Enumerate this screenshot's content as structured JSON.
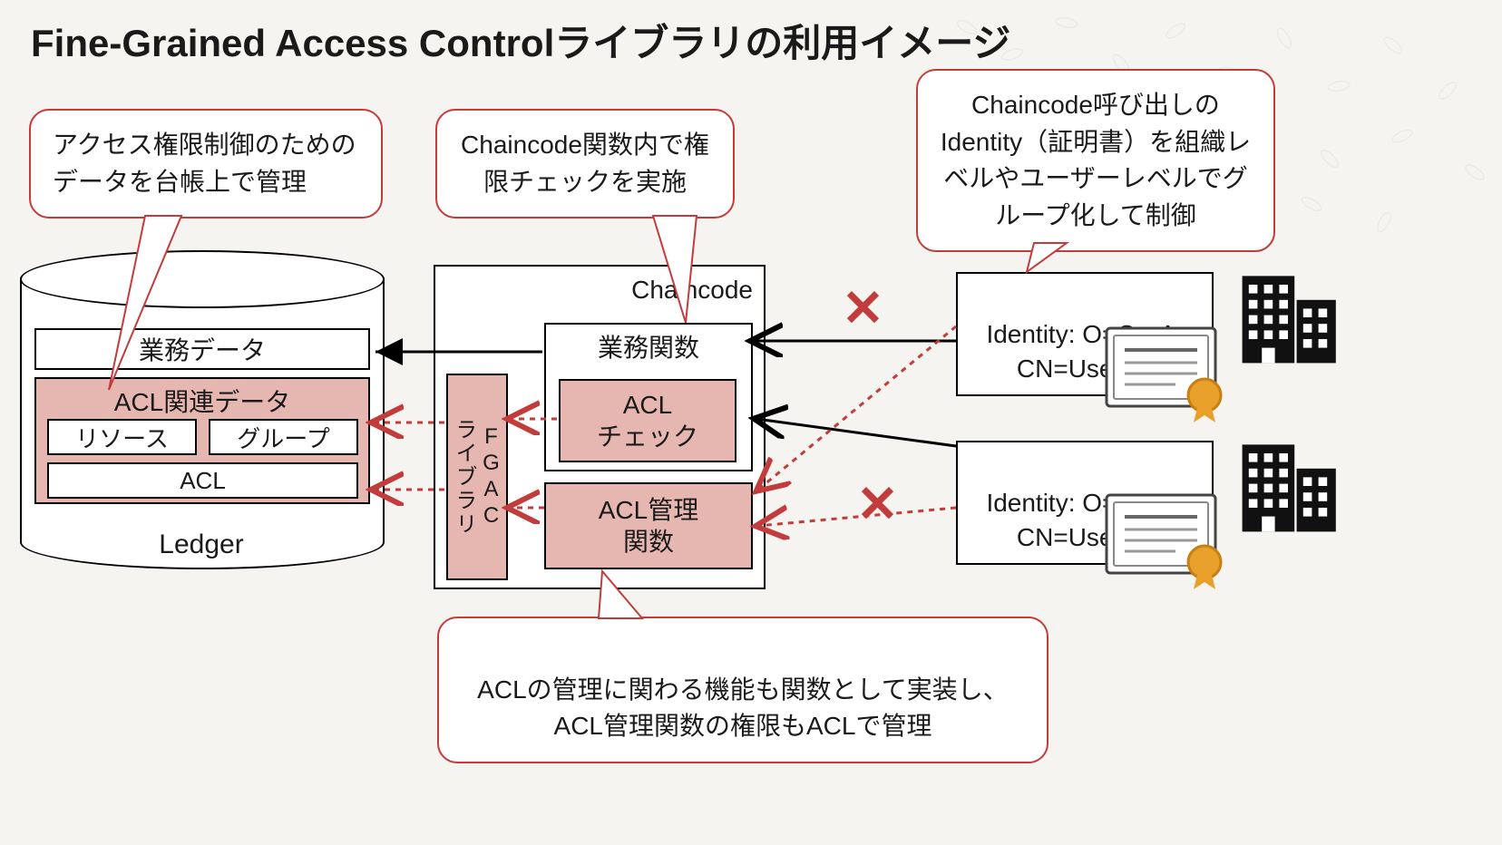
{
  "title": "Fine-Grained Access Controlライブラリの利用イメージ",
  "callouts": {
    "ledger_callout": "アクセス権限制御のためのデータを台帳上で管理",
    "chaincode_callout": "Chaincode関数内で権限チェックを実施",
    "identity_callout": "Chaincode呼び出しのIdentity（証明書）を組織レベルやユーザーレベルでグループ化して制御",
    "acl_mgmt_callout": "ACLの管理に関わる機能も関数として実装し、\nACL管理関数の権限もACLで管理"
  },
  "ledger": {
    "label": "Ledger",
    "business_data": "業務データ",
    "acl_related": "ACL関連データ",
    "resource": "リソース",
    "group": "グループ",
    "acl": "ACL"
  },
  "chaincode": {
    "label": "Chaincode",
    "business_fn": "業務関数",
    "acl_check": "ACL\nチェック",
    "fgac_lib": "FGAC\nライブラリ",
    "acl_mgmt_fn": "ACL管理\n関数"
  },
  "identity": {
    "a": "Identity: O=OrgA,\nCN=UserA1",
    "b": "Identity: O=OrgB,\nCN=UserB1"
  },
  "markers": {
    "deny": "✕"
  },
  "colors": {
    "accent": "#c33c3c",
    "pink_fill": "#e6b6b1"
  }
}
